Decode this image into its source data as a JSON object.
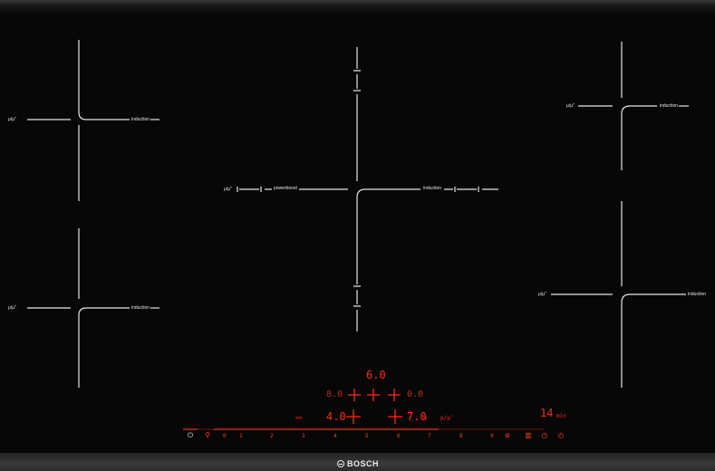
{
  "brand": "BOSCH",
  "zones": {
    "front_left_top": {
      "left_label": "μ/µ″",
      "right_label": "induction"
    },
    "front_left_bottom": {
      "left_label": "μ/µ″",
      "right_label": "induction"
    },
    "center": {
      "left_label": "μ/µ″",
      "boost_label": "powerboost",
      "right_label": "induction"
    },
    "right_top": {
      "left_label": "μ/µ″",
      "right_label": "induction"
    },
    "right_bottom": {
      "left_label": "μ/µ″",
      "right_label": "induction"
    }
  },
  "display": {
    "top_level": "6.0",
    "mid_left_level": "8.0",
    "mid_right_level": "0.0",
    "lower_left_level": "4.0",
    "lower_right_level": "7.0",
    "timer_value": "14",
    "timer_unit": "min",
    "small_left_label": "∞∞",
    "small_right_label": "μ/µ″"
  },
  "controls": {
    "power_icon": "power-icon",
    "child_lock_icon": "child-lock-icon",
    "slider_values": [
      "0",
      "·",
      "1",
      "·",
      "2",
      "·",
      "3",
      "·",
      "4",
      "·",
      "5",
      "·",
      "6",
      "·",
      "7",
      "·",
      "8",
      "·",
      "9"
    ],
    "boost_icon": "boost-icon",
    "wipe_icon": "wipe-protection-icon",
    "timer_icon": "timer-icon",
    "clock_icon": "clock-icon"
  },
  "colors": {
    "display_red": "#ff2a1a",
    "line_white": "#e6e6e6",
    "glass": "#070707"
  }
}
